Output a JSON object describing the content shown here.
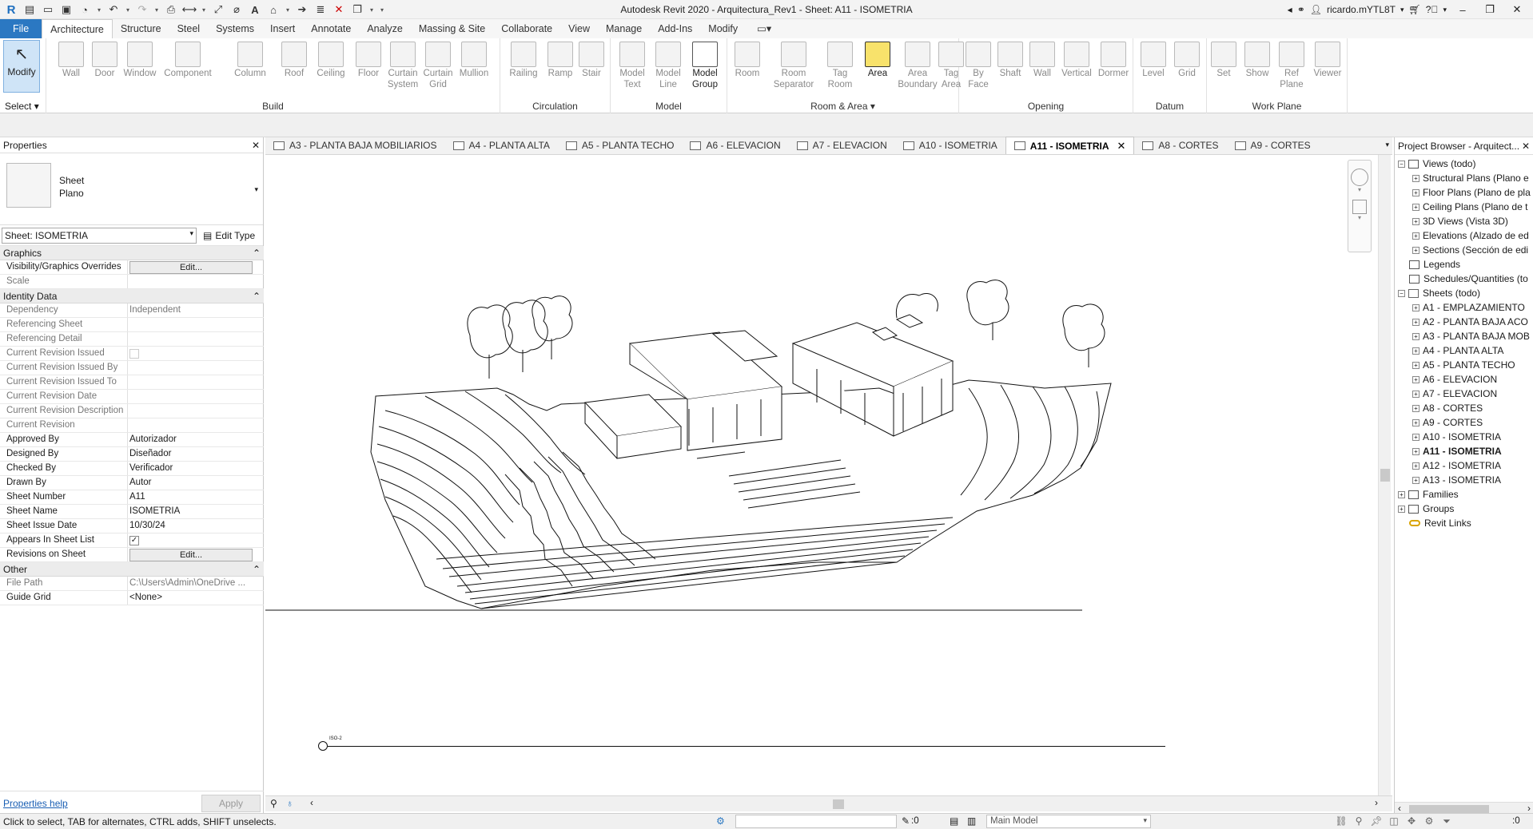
{
  "app": {
    "title": "Autodesk Revit 2020 - Arquitectura_Rev1 - Sheet: A11 - ISOMETRIA",
    "user": "ricardo.mYTL8T",
    "colors": {
      "file_tab": "#2b78c2",
      "modify_active": "#cfe4f7",
      "area_tool": "#f8e26b",
      "link": "#1a5fb4"
    }
  },
  "menu": {
    "file": "File",
    "tabs": [
      "Architecture",
      "Structure",
      "Steel",
      "Systems",
      "Insert",
      "Annotate",
      "Analyze",
      "Massing & Site",
      "Collaborate",
      "View",
      "Manage",
      "Add-Ins",
      "Modify"
    ],
    "active_tab": "Architecture"
  },
  "ribbon": {
    "select_label": "Select",
    "modify_label": "Modify",
    "panels": {
      "build": {
        "label": "Build",
        "tools": [
          "Wall",
          "Door",
          "Window",
          "Component",
          "Column",
          "Roof",
          "Ceiling",
          "Floor",
          "Curtain System",
          "Curtain Grid",
          "Mullion"
        ]
      },
      "circulation": {
        "label": "Circulation",
        "tools": [
          "Railing",
          "Ramp",
          "Stair"
        ]
      },
      "model": {
        "label": "Model",
        "tools": [
          "Model Text",
          "Model Line",
          "Model Group"
        ]
      },
      "room": {
        "label": "Room & Area",
        "tools": [
          "Room",
          "Room Separator",
          "Tag Room",
          "Area",
          "Area Boundary",
          "Tag Area"
        ]
      },
      "opening": {
        "label": "Opening",
        "tools": [
          "By Face",
          "Shaft",
          "Wall",
          "Vertical",
          "Dormer"
        ]
      },
      "datum": {
        "label": "Datum",
        "tools": [
          "Level",
          "Grid"
        ]
      },
      "workplane": {
        "label": "Work Plane",
        "tools": [
          "Set",
          "Show",
          "Ref Plane",
          "Viewer"
        ]
      }
    }
  },
  "properties": {
    "title": "Properties",
    "type_line1": "Sheet",
    "type_line2": "Plano",
    "instance_selector": "Sheet: ISOMETRIA",
    "edit_type": "Edit Type",
    "sections": {
      "graphics": "Graphics",
      "identity": "Identity Data",
      "other": "Other"
    },
    "rows": {
      "vis_overrides": {
        "key": "Visibility/Graphics Overrides",
        "value": "Edit..."
      },
      "scale": {
        "key": "Scale",
        "value": ""
      },
      "dependency": {
        "key": "Dependency",
        "value": "Independent"
      },
      "ref_sheet": {
        "key": "Referencing Sheet",
        "value": ""
      },
      "ref_detail": {
        "key": "Referencing Detail",
        "value": ""
      },
      "cur_rev_issued": {
        "key": "Current Revision Issued",
        "value": ""
      },
      "cur_rev_issued_by": {
        "key": "Current Revision Issued By",
        "value": ""
      },
      "cur_rev_issued_to": {
        "key": "Current Revision Issued To",
        "value": ""
      },
      "cur_rev_date": {
        "key": "Current Revision Date",
        "value": ""
      },
      "cur_rev_desc": {
        "key": "Current Revision Description",
        "value": ""
      },
      "cur_rev": {
        "key": "Current Revision",
        "value": ""
      },
      "approved_by": {
        "key": "Approved By",
        "value": "Autorizador"
      },
      "designed_by": {
        "key": "Designed By",
        "value": "Diseñador"
      },
      "checked_by": {
        "key": "Checked By",
        "value": "Verificador"
      },
      "drawn_by": {
        "key": "Drawn By",
        "value": "Autor"
      },
      "sheet_number": {
        "key": "Sheet Number",
        "value": "A11"
      },
      "sheet_name": {
        "key": "Sheet Name",
        "value": "ISOMETRIA"
      },
      "sheet_issue_date": {
        "key": "Sheet Issue Date",
        "value": "10/30/24"
      },
      "appears_in_list": {
        "key": "Appears In Sheet List",
        "value": "✓"
      },
      "revisions_on_sheet": {
        "key": "Revisions on Sheet",
        "value": "Edit..."
      },
      "file_path": {
        "key": "File Path",
        "value": "C:\\Users\\Admin\\OneDrive ..."
      },
      "guide_grid": {
        "key": "Guide Grid",
        "value": "<None>"
      }
    },
    "help_link": "Properties help",
    "apply": "Apply"
  },
  "view_tabs": {
    "tabs": [
      "A3 - PLANTA BAJA MOBILIARIOS",
      "A4 - PLANTA ALTA",
      "A5 - PLANTA TECHO",
      "A6 - ELEVACION",
      "A7 - ELEVACION",
      "A10 - ISOMETRIA",
      "A11 - ISOMETRIA",
      "A8 - CORTES",
      "A9 - CORTES"
    ],
    "active": "A11 - ISOMETRIA"
  },
  "canvas": {
    "view_tag": "ISO-2"
  },
  "project_browser": {
    "title": "Project Browser - Arquitect...",
    "views_root": "Views (todo)",
    "views": [
      "Structural Plans (Plano e",
      "Floor Plans (Plano de pla",
      "Ceiling Plans (Plano de t",
      "3D Views (Vista 3D)",
      "Elevations (Alzado de ed",
      "Sections (Sección de edi"
    ],
    "legends": "Legends",
    "schedules": "Schedules/Quantities (to",
    "sheets_root": "Sheets (todo)",
    "sheets": [
      "A1 - EMPLAZAMIENTO",
      "A2 - PLANTA BAJA ACO",
      "A3 - PLANTA BAJA MOB",
      "A4 - PLANTA ALTA",
      "A5 - PLANTA TECHO",
      "A6 - ELEVACION",
      "A7 - ELEVACION",
      "A8 - CORTES",
      "A9 - CORTES",
      "A10 - ISOMETRIA",
      "A11 - ISOMETRIA",
      "A12 - ISOMETRIA",
      "A13 - ISOMETRIA"
    ],
    "active_sheet": "A11 - ISOMETRIA",
    "families": "Families",
    "groups": "Groups",
    "revit_links": "Revit Links"
  },
  "status": {
    "message": "Click to select, TAB for alternates, CTRL adds, SHIFT unselects.",
    "workset_count": ":0",
    "design_option": "Main Model",
    "filter_count": ":0"
  }
}
